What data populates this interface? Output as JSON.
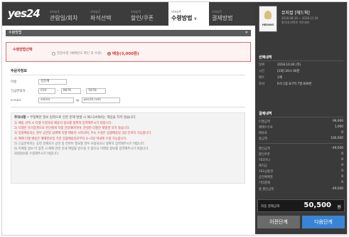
{
  "logo": "yes24",
  "steps": [
    {
      "num": "step1",
      "label": "관람일/회차",
      "active": false
    },
    {
      "num": "step2",
      "label": "좌석선택",
      "active": false
    },
    {
      "num": "step3",
      "label": "할인/쿠폰",
      "active": false
    },
    {
      "num": "step4",
      "label": "수령방법",
      "active": true
    },
    {
      "num": "step5",
      "label": "결제방법",
      "active": false
    }
  ],
  "section_bar": "수령방법",
  "pay_method": {
    "label": "수령방법선택",
    "option1": "현장수령 (예매번호 확인 후 수령)",
    "option2": "배송(3,000원)"
  },
  "orderer": {
    "title": "주문자정보",
    "name_label": "이름",
    "name_value": "김진혜",
    "phone_label": "긴급연락처",
    "phone1": "010",
    "phone2": "9876",
    "phone3": "5678",
    "email_label": "e-mail",
    "email_id": "sekiro",
    "email_at": "@",
    "email_domain": "yes24.com"
  },
  "notice": {
    "heading_bold": "주의사항",
    "heading_rest": " • 부정확한 정보 입력으로 인한 문제 발생 시 예스24에서는 책임을 지지 않습니다.",
    "lines": [
      {
        "text": "1) 배송 선택 시 티켓 수령자의 배송지 정보를 정확히 입력해주시기 바랍니다.",
        "red": true
      },
      {
        "text": "2) 티켓은 유가증권으로 본인에게 직접 전달해야하며, 분실된 티켓은 재발권 되지 않습니다.",
        "red": true
      },
      {
        "text": "3) 일괄배송되는 경우 공연일 날짜에 티켓 배송이 시작되며, 주소 수정은 일괄배송일 3일 전까지 가능합니다.",
        "red": true
      },
      {
        "text": "4) 예매 티켓 배송은 예매완료일 기준 일괄배송일로부터 4~5일 이내에 수령 가능합니다.",
        "red": true
      },
      {
        "text": "5) 긴급연락처는 공연 관계자가 공연 중 연락이 필요할 경우 사용되오니 정확히 입력해주시기 바랍니다.",
        "red": false
      },
      {
        "text": "6) 이메일 정보 미 입력 시 예매 관련 안내 메일을 받으실 수 없으니 이메일 정보를 입력해주시기 바랍니다.",
        "red": false
      },
      {
        "text": "   회원정보를 수정해주시기 바랍니다.",
        "red": false
      }
    ]
  },
  "right": {
    "show_title": "뮤지컬 [헤드윅]",
    "show_period": "2018.08.16 ~ 2018.11.04",
    "show_venue": "홍익대 대학로 아트센터",
    "poster_title": "HEDWIG",
    "selected_title": "선택내역",
    "selected_rows": [
      {
        "k": "날짜",
        "v": "2018.10.04 (목)"
      },
      {
        "k": "시간",
        "v": "[1회] 20시 00분"
      },
      {
        "k": "매수",
        "v": "1매"
      },
      {
        "k": "좌석",
        "v": "R석 1층 8구역 7열 009번"
      }
    ],
    "price_title": "결제내역",
    "price_rows": [
      {
        "k": "티켓금액",
        "v": "99,000"
      },
      {
        "k": "예매수수료",
        "v": "1,000"
      },
      {
        "k": "배송료",
        "v": "0"
      },
      {
        "k": "총금액",
        "v": "100,000"
      }
    ],
    "discount_rows": [
      {
        "k": "할인금액",
        "v": "-49,500"
      },
      {
        "k": "할인쿠폰",
        "v": "0"
      },
      {
        "k": "YES머니",
        "v": "0"
      },
      {
        "k": "예치금",
        "v": "0"
      },
      {
        "k": "YES상품권",
        "v": "0"
      },
      {
        "k": "공연예매권",
        "v": "0"
      },
      {
        "k": "기타결제",
        "v": "0"
      },
      {
        "k": "총 할인금액",
        "v": "-49,500"
      }
    ],
    "total_label": "최종 결제금액",
    "total_value": "50,500",
    "total_unit": "원",
    "prev_btn": "이전단계",
    "next_btn": "다음단계"
  }
}
